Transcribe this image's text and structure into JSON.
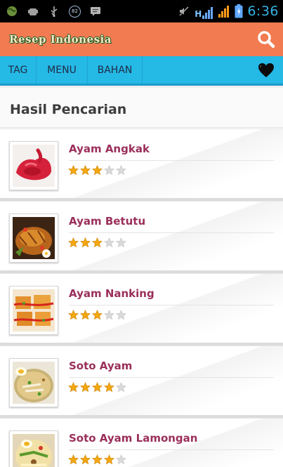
{
  "status_bar": {
    "time": "6:36",
    "notification_count": "82",
    "network_type": "H"
  },
  "app_bar": {
    "title": "Resep Indonesia"
  },
  "tabs": [
    {
      "label": "TAG"
    },
    {
      "label": "MENU"
    },
    {
      "label": "BAHAN"
    }
  ],
  "section": {
    "title": "Hasil Pencarian"
  },
  "recipes": [
    {
      "name": "Ayam Angkak",
      "rating": 3,
      "max_rating": 5
    },
    {
      "name": "Ayam Betutu",
      "rating": 3,
      "max_rating": 5
    },
    {
      "name": "Ayam Nanking",
      "rating": 3,
      "max_rating": 5
    },
    {
      "name": "Soto Ayam",
      "rating": 4,
      "max_rating": 5
    },
    {
      "name": "Soto Ayam Lamongan",
      "rating": 4,
      "max_rating": 5
    }
  ],
  "colors": {
    "app_bar": "#f27b51",
    "tab_bar": "#25b9e6",
    "recipe_title": "#9a2f5a",
    "star_filled": "#f3a712",
    "star_empty": "#d9d9d9",
    "status_time": "#33b5e5"
  },
  "icons": {
    "search": "search-icon",
    "favorites": "heart-icon"
  }
}
